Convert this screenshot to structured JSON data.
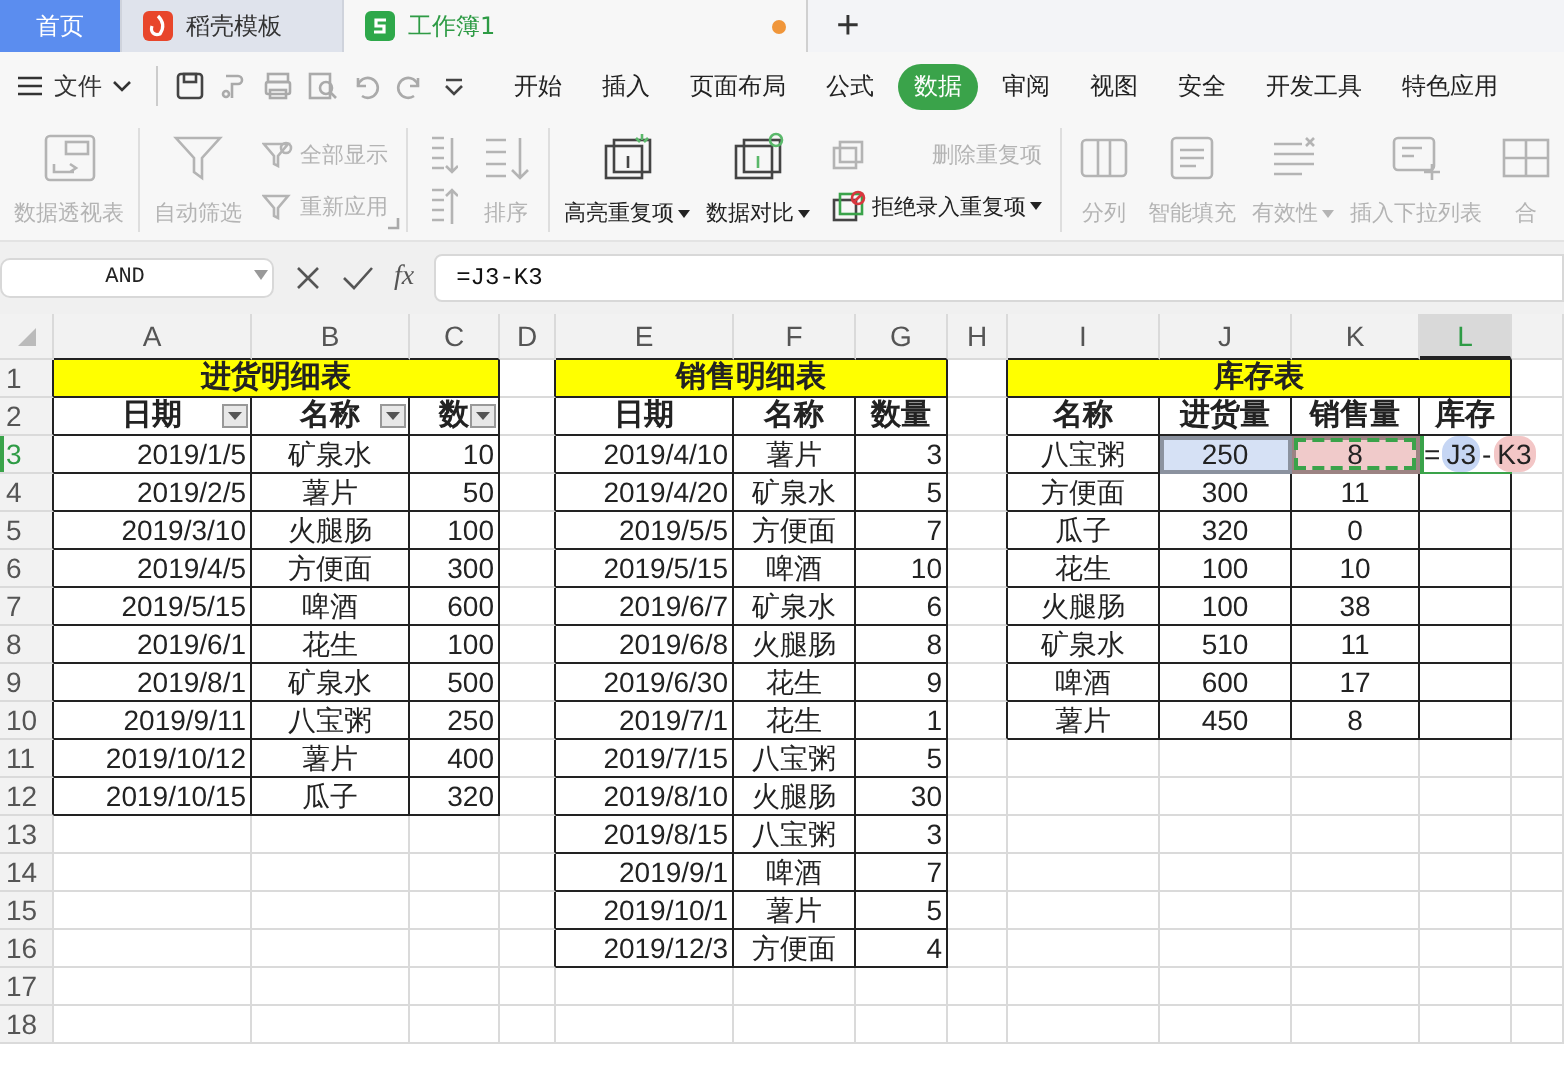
{
  "tabs": [
    {
      "label": "首页",
      "kind": "home",
      "selected": false
    },
    {
      "label": "稻壳模板",
      "kind": "docer",
      "selected": false
    },
    {
      "label": "工作簿1",
      "kind": "sheet",
      "selected": true,
      "modified": true
    }
  ],
  "new_tab": "+",
  "file_menu": "文件",
  "menu_tabs": [
    {
      "label": "开始",
      "selected": false
    },
    {
      "label": "插入",
      "selected": false
    },
    {
      "label": "页面布局",
      "selected": false
    },
    {
      "label": "公式",
      "selected": false
    },
    {
      "label": "数据",
      "selected": true
    },
    {
      "label": "审阅",
      "selected": false
    },
    {
      "label": "视图",
      "selected": false
    },
    {
      "label": "安全",
      "selected": false
    },
    {
      "label": "开发工具",
      "selected": false
    },
    {
      "label": "特色应用",
      "selected": false
    }
  ],
  "ribbon": {
    "groups": [
      {
        "columns": [
          {
            "kind": "large",
            "items": [
              {
                "label": "数据透视表",
                "disabled": true
              }
            ]
          }
        ]
      },
      {
        "launcher": true,
        "columns": [
          {
            "kind": "large",
            "items": [
              {
                "label": "自动筛选",
                "disabled": true
              }
            ]
          },
          {
            "kind": "stack",
            "items": [
              {
                "label": "全部显示",
                "disabled": true
              },
              {
                "label": "重新应用",
                "disabled": true
              }
            ]
          }
        ]
      },
      {
        "columns": [
          {
            "kind": "stack",
            "items": [
              {
                "disabled": true
              },
              {
                "disabled": true
              }
            ]
          },
          {
            "kind": "large",
            "items": [
              {
                "label": "排序",
                "disabled": true
              }
            ]
          }
        ]
      },
      {
        "columns": [
          {
            "kind": "large",
            "items": [
              {
                "label": "高亮重复项",
                "disabled": false,
                "dropdown": true
              }
            ]
          },
          {
            "kind": "large",
            "items": [
              {
                "label": "数据对比",
                "disabled": false,
                "dropdown": true
              }
            ]
          },
          {
            "kind": "stack",
            "items": [
              {
                "label": "删除重复项",
                "disabled": true
              },
              {
                "label": "拒绝录入重复项",
                "disabled": false,
                "dropdown": true
              }
            ]
          }
        ]
      },
      {
        "columns": [
          {
            "kind": "large",
            "items": [
              {
                "label": "分列",
                "disabled": true
              }
            ]
          },
          {
            "kind": "large",
            "items": [
              {
                "label": "智能填充",
                "disabled": true
              }
            ]
          },
          {
            "kind": "large",
            "items": [
              {
                "label": "有效性",
                "disabled": true,
                "dropdown": true
              }
            ]
          },
          {
            "kind": "large",
            "items": [
              {
                "label": "插入下拉列表",
                "disabled": true
              }
            ]
          },
          {
            "kind": "large",
            "items": [
              {
                "label": "合",
                "disabled": true
              }
            ]
          }
        ]
      }
    ]
  },
  "formula_bar": {
    "name_box": "AND",
    "function_label": "fx",
    "formula": "=J3-K3"
  },
  "sheet": {
    "columns": [
      "A",
      "B",
      "C",
      "D",
      "E",
      "F",
      "G",
      "H",
      "I",
      "J",
      "K",
      "L"
    ],
    "rows": [
      "1",
      "2",
      "3",
      "4",
      "5",
      "6",
      "7",
      "8",
      "9",
      "10",
      "11",
      "12",
      "13",
      "14",
      "15",
      "16",
      "17",
      "18"
    ],
    "tables": [
      {
        "kind": "detail",
        "title": "进货明细表",
        "headers": [
          {
            "label": "日期",
            "filter": true
          },
          {
            "label": "名称",
            "filter": true
          },
          {
            "label": "数",
            "filter": true
          }
        ],
        "rows": [
          [
            "2019/1/5",
            "矿泉水",
            "10"
          ],
          [
            "2019/2/5",
            "薯片",
            "50"
          ],
          [
            "2019/3/10",
            "火腿肠",
            "100"
          ],
          [
            "2019/4/5",
            "方便面",
            "300"
          ],
          [
            "2019/5/15",
            "啤酒",
            "600"
          ],
          [
            "2019/6/1",
            "花生",
            "100"
          ],
          [
            "2019/8/1",
            "矿泉水",
            "500"
          ],
          [
            "2019/9/11",
            "八宝粥",
            "250"
          ],
          [
            "2019/10/12",
            "薯片",
            "400"
          ],
          [
            "2019/10/15",
            "瓜子",
            "320"
          ]
        ]
      },
      {
        "kind": "detail",
        "title": "销售明细表",
        "headers": [
          {
            "label": "日期"
          },
          {
            "label": "名称"
          },
          {
            "label": "数量"
          }
        ],
        "rows": [
          [
            "2019/4/10",
            "薯片",
            "3"
          ],
          [
            "2019/4/20",
            "矿泉水",
            "5"
          ],
          [
            "2019/5/5",
            "方便面",
            "7"
          ],
          [
            "2019/5/15",
            "啤酒",
            "10"
          ],
          [
            "2019/6/7",
            "矿泉水",
            "6"
          ],
          [
            "2019/6/8",
            "火腿肠",
            "8"
          ],
          [
            "2019/6/30",
            "花生",
            "9"
          ],
          [
            "2019/7/1",
            "花生",
            "1"
          ],
          [
            "2019/7/15",
            "八宝粥",
            "5"
          ],
          [
            "2019/8/10",
            "火腿肠",
            "30"
          ],
          [
            "2019/8/15",
            "八宝粥",
            "3"
          ],
          [
            "2019/9/1",
            "啤酒",
            "7"
          ],
          [
            "2019/10/1",
            "薯片",
            "5"
          ],
          [
            "2019/12/3",
            "方便面",
            "4"
          ]
        ]
      },
      {
        "kind": "summary",
        "title": "库存表",
        "headers": [
          {
            "label": "名称"
          },
          {
            "label": "进货量"
          },
          {
            "label": "销售量"
          },
          {
            "label": "库存"
          }
        ],
        "rows": [
          [
            "八宝粥",
            {
              "text": "250",
              "color": "#d6e1f5"
            },
            {
              "text": "8",
              "color": "#f0caca",
              "marquee": true
            },
            {
              "active": true,
              "formula": [
                {
                  "text": "=",
                  "kind": "plain"
                },
                {
                  "text": "J3",
                  "kind": "ref",
                  "color": "#c6d6f4"
                },
                {
                  "text": "-",
                  "kind": "plain"
                },
                {
                  "text": "K3",
                  "kind": "ref",
                  "color": "#f3c6c6"
                }
              ]
            }
          ],
          [
            "方便面",
            "300",
            "11"
          ],
          [
            "瓜子",
            "320",
            "0"
          ],
          [
            "花生",
            "100",
            "10"
          ],
          [
            "火腿肠",
            "100",
            "38"
          ],
          [
            "矿泉水",
            "510",
            "11"
          ],
          [
            "啤酒",
            "600",
            "17"
          ],
          [
            "薯片",
            "450",
            "8"
          ]
        ]
      }
    ]
  }
}
